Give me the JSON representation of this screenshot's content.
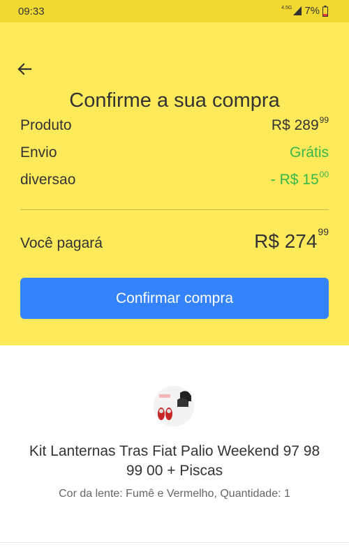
{
  "status_bar": {
    "time": "09:33",
    "network": "4.5G",
    "battery": "7%"
  },
  "header": {
    "back_icon": "arrow-left-icon",
    "title": "Confirme a sua compra"
  },
  "summary": {
    "product_label": "Produto",
    "product_value": "R$ 289",
    "product_cents": "99",
    "shipping_label": "Envio",
    "shipping_value": "Grátis",
    "discount_label": "diversao",
    "discount_value": "- R$ 15",
    "discount_cents": "00",
    "total_label": "Você pagará",
    "total_value": "R$ 274",
    "total_cents": "99"
  },
  "confirm_button": {
    "label": "Confirmar compra"
  },
  "product": {
    "title": "Kit Lanternas Tras Fiat Palio Weekend 97 98 99 00 + Piscas",
    "variant": "Cor da lente: Fumê e Vermelho, Quantidade: 1"
  },
  "colors": {
    "status_bar": "#f2d931",
    "header_bg": "#fdea5b",
    "accent_blue": "#3483fa",
    "green": "#39b54a",
    "text": "#333333"
  }
}
